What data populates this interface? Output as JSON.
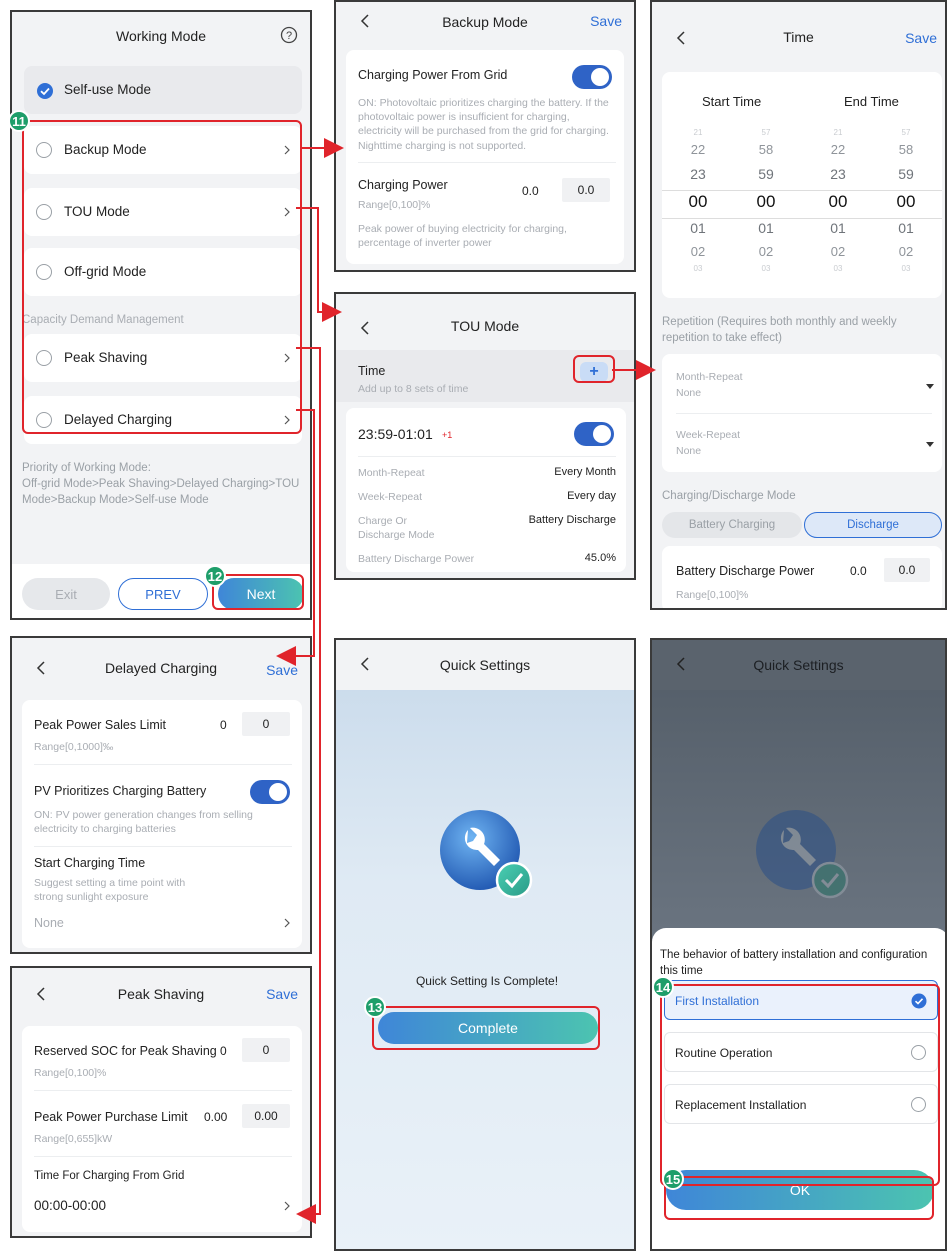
{
  "working_mode": {
    "title": "Working Mode",
    "items": [
      {
        "label": "Self-use Mode",
        "selected": true
      },
      {
        "label": "Backup Mode"
      },
      {
        "label": "TOU Mode"
      },
      {
        "label": "Off-grid Mode"
      }
    ],
    "section_label": "Capacity Demand Management",
    "capacity_items": [
      {
        "label": "Peak Shaving"
      },
      {
        "label": "Delayed Charging"
      }
    ],
    "priority_note": "Priority of Working Mode:\nOff-grid Mode>Peak Shaving>Delayed Charging>TOU Mode>Backup Mode>Self-use Mode",
    "exit_label": "Exit",
    "prev_label": "PREV",
    "next_label": "Next"
  },
  "backup_mode": {
    "title": "Backup Mode",
    "save_label": "Save",
    "charging_from_grid_label": "Charging Power From Grid",
    "charging_from_grid_desc": "ON: Photovoltaic prioritizes charging the battery. If the photovoltaic power is insufficient for charging, electricity will be purchased from the grid for charging. Nighttime charging is not supported.",
    "charging_power_label": "Charging Power",
    "charging_power_value": "0.0",
    "charging_power_input": "0.0",
    "charging_power_range": "Range[0,100]%",
    "charging_power_desc": "Peak power of buying electricity for charging, percentage of inverter power"
  },
  "time_screen": {
    "title": "Time",
    "save_label": "Save",
    "start_label": "Start Time",
    "end_label": "End Time",
    "columns": [
      [
        "21",
        "22",
        "23",
        "00",
        "01",
        "02",
        "03"
      ],
      [
        "57",
        "58",
        "59",
        "00",
        "01",
        "02",
        "03"
      ],
      [
        "21",
        "22",
        "23",
        "00",
        "01",
        "02",
        "03"
      ],
      [
        "57",
        "58",
        "59",
        "00",
        "01",
        "02",
        "03"
      ]
    ],
    "repetition_note": "Repetition (Requires both monthly and weekly repetition to take effect)",
    "month_repeat_label": "Month-Repeat",
    "month_repeat_value": "None",
    "week_repeat_label": "Week-Repeat",
    "week_repeat_value": "None",
    "mode_label": "Charging/Discharge Mode",
    "mode_options": [
      "Battery Charging",
      "Discharge"
    ],
    "discharge_power_label": "Battery Discharge Power",
    "discharge_power_value": "0.0",
    "discharge_power_input": "0.0",
    "discharge_power_range": "Range[0,100]%"
  },
  "tou_mode": {
    "title": "TOU Mode",
    "time_label": "Time",
    "time_desc": "Add up to 8 sets of time",
    "add_symbol": "+",
    "entry_time": "23:59-01:01",
    "entry_suffix": "+1",
    "rows": [
      {
        "label": "Month-Repeat",
        "value": "Every Month"
      },
      {
        "label": "Week-Repeat",
        "value": "Every day"
      },
      {
        "label": "Charge Or\nDischarge Mode",
        "value": "Battery Discharge"
      },
      {
        "label": "Battery Discharge Power",
        "value": "45.0%"
      }
    ]
  },
  "delayed_charging": {
    "title": "Delayed Charging",
    "save_label": "Save",
    "sales_limit_label": "Peak Power Sales Limit",
    "sales_limit_value": "0",
    "sales_limit_input": "0",
    "sales_limit_range": "Range[0,1000]‰",
    "pv_priority_label": "PV Prioritizes Charging Battery",
    "pv_priority_desc": "ON: PV power generation changes from selling electricity to charging batteries",
    "start_time_label": "Start Charging Time",
    "start_time_desc": "Suggest setting a time point with strong sunlight exposure",
    "start_time_value": "None"
  },
  "peak_shaving": {
    "title": "Peak Shaving",
    "save_label": "Save",
    "reserved_soc_label": "Reserved SOC for Peak Shaving",
    "reserved_soc_value": "0",
    "reserved_soc_input": "0",
    "reserved_soc_range": "Range[0,100]%",
    "purchase_limit_label": "Peak Power Purchase Limit",
    "purchase_limit_value": "0.00",
    "purchase_limit_input": "0.00",
    "purchase_limit_range": "Range[0,655]kW",
    "grid_time_label": "Time For Charging From Grid",
    "grid_time_value": "00:00-00:00"
  },
  "quick_settings": {
    "title": "Quick Settings",
    "complete_msg": "Quick Setting Is Complete!",
    "complete_label": "Complete"
  },
  "quick_settings_sheet": {
    "title": "Quick Settings",
    "prompt": "The behavior of battery installation and configuration this time",
    "options": [
      {
        "label": "First Installation",
        "selected": true
      },
      {
        "label": "Routine Operation"
      },
      {
        "label": "Replacement Installation"
      }
    ],
    "ok_label": "OK"
  },
  "badges": [
    "11",
    "12",
    "13",
    "14",
    "15"
  ],
  "colors": {
    "accent": "#2f6fd6",
    "toggle_on": "#2f63c6",
    "highlight": "#e0242b",
    "badge": "#1e9e6a",
    "gradient_start": "#3f86d8",
    "gradient_end": "#4cc4b0"
  }
}
